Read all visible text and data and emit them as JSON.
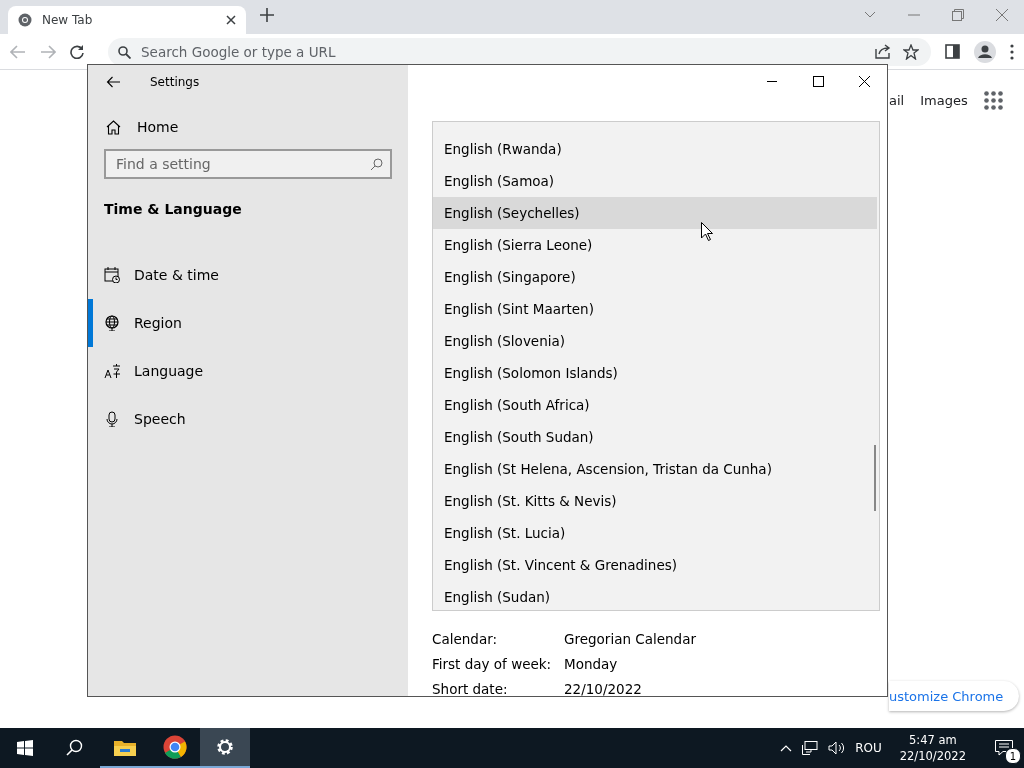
{
  "browser": {
    "tab": {
      "title": "New Tab",
      "selected": true
    },
    "address": {
      "placeholder": "Search Google or type a URL"
    },
    "page": {
      "links": [
        "ail",
        "Images"
      ],
      "customize_button": "ustomize Chrome"
    }
  },
  "settings": {
    "title": "Settings",
    "home": "Home",
    "search": {
      "placeholder": "Find a setting"
    },
    "section": "Time & Language",
    "nav": [
      {
        "label": "Date & time",
        "kind": "calendar",
        "selected": false
      },
      {
        "label": "Region",
        "kind": "globe",
        "selected": true
      },
      {
        "label": "Language",
        "kind": "language",
        "selected": false
      },
      {
        "label": "Speech",
        "kind": "mic",
        "selected": false
      }
    ],
    "list": [
      {
        "label": "English (Rwanda)",
        "highlighted": false
      },
      {
        "label": "English (Samoa)",
        "highlighted": false
      },
      {
        "label": "English (Seychelles)",
        "highlighted": true
      },
      {
        "label": "English (Sierra Leone)",
        "highlighted": false
      },
      {
        "label": "English (Singapore)",
        "highlighted": false
      },
      {
        "label": "English (Sint Maarten)",
        "highlighted": false
      },
      {
        "label": "English (Slovenia)",
        "highlighted": false
      },
      {
        "label": "English (Solomon Islands)",
        "highlighted": false
      },
      {
        "label": "English (South Africa)",
        "highlighted": false
      },
      {
        "label": "English (South Sudan)",
        "highlighted": false
      },
      {
        "label": "English (St Helena, Ascension, Tristan da Cunha)",
        "highlighted": false
      },
      {
        "label": "English (St. Kitts & Nevis)",
        "highlighted": false
      },
      {
        "label": "English (St. Lucia)",
        "highlighted": false
      },
      {
        "label": "English (St. Vincent & Grenadines)",
        "highlighted": false
      },
      {
        "label": "English (Sudan)",
        "highlighted": false
      }
    ],
    "details": [
      {
        "label": "Calendar:",
        "value": "Gregorian Calendar"
      },
      {
        "label": "First day of week:",
        "value": "Monday"
      },
      {
        "label": "Short date:",
        "value": "22/10/2022"
      }
    ]
  },
  "taskbar": {
    "apps": [
      {
        "kind": "search",
        "active": false,
        "running": false
      },
      {
        "kind": "folder",
        "active": false,
        "running": true
      },
      {
        "kind": "chrome",
        "active": false,
        "running": true
      },
      {
        "kind": "gear",
        "active": true,
        "running": true
      }
    ],
    "language": "ROU",
    "time": "5:47 am",
    "date": "22/10/2022",
    "notifications": "1"
  }
}
